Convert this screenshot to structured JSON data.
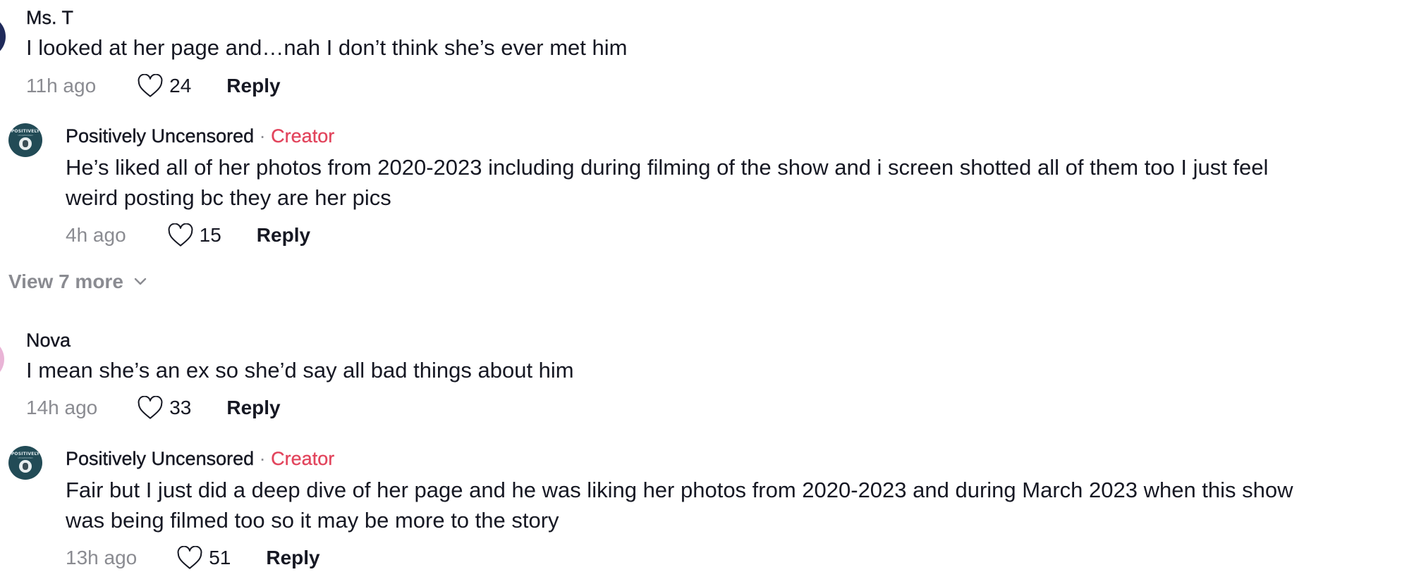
{
  "comments": [
    {
      "username": "Ms. T",
      "text": "I looked at her page and…nah I don’t think she’s ever met him",
      "time": "11h ago",
      "likes": "24",
      "reply_label": "Reply"
    },
    {
      "username": "Positively Uncensored",
      "separator": "·",
      "badge": "Creator",
      "text_line1": "He’s liked all of her photos from 2020-2023 including during filming of the show and i screen shotted all of them too I just feel",
      "text_line2": "weird posting bc they are her pics",
      "time": "4h ago",
      "likes": "15",
      "reply_label": "Reply",
      "avatar_brand": "POSITIVELY",
      "avatar_sub": "UNCENSORED"
    },
    {
      "username": "Nova",
      "text": "I mean she’s an ex so she’d say all bad things about him",
      "time": "14h ago",
      "likes": "33",
      "reply_label": "Reply"
    },
    {
      "username": "Positively Uncensored",
      "separator": "·",
      "badge": "Creator",
      "text_line1": "Fair but I just did a deep dive of her page and he was liking her photos from 2020-2023 and during March 2023 when this show",
      "text_line2": "was being filmed too so it may be more to the story",
      "time": "13h ago",
      "likes": "51",
      "reply_label": "Reply",
      "avatar_brand": "POSITIVELY",
      "avatar_sub": "UNCENSORED"
    }
  ],
  "view_more": {
    "label": "View 7 more",
    "icon": "chevron-down-icon"
  },
  "icons": {
    "like": "heart-outline-icon"
  },
  "colors": {
    "text": "#161823",
    "muted": "#8a8b91",
    "creator_badge": "#e2445c",
    "creator_avatar_bg": "#224b56"
  }
}
